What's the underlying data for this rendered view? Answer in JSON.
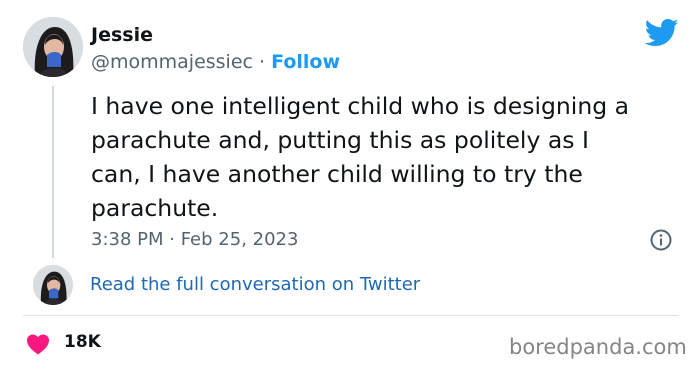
{
  "author": {
    "name": "Jessie",
    "handle": "@mommajessiec",
    "separator": "·",
    "follow_label": "Follow"
  },
  "tweet": {
    "text": "I have one intelligent child who is designing a\nparachute and, putting this as politely as I\ncan, I have another child willing to try the\nparachute.",
    "timestamp": "3:38 PM · Feb 25, 2023"
  },
  "conversation_link": "Read the full conversation on Twitter",
  "engagement": {
    "likes": "18K"
  },
  "watermark": "boredpanda.com",
  "icons": {
    "brand": "twitter-bird-icon",
    "info": "info-icon",
    "like": "heart-icon"
  },
  "colors": {
    "twitter_blue": "#1d9bf0",
    "link_blue": "#1d69b5",
    "heart_red": "#f91880",
    "muted_text": "#536471"
  }
}
